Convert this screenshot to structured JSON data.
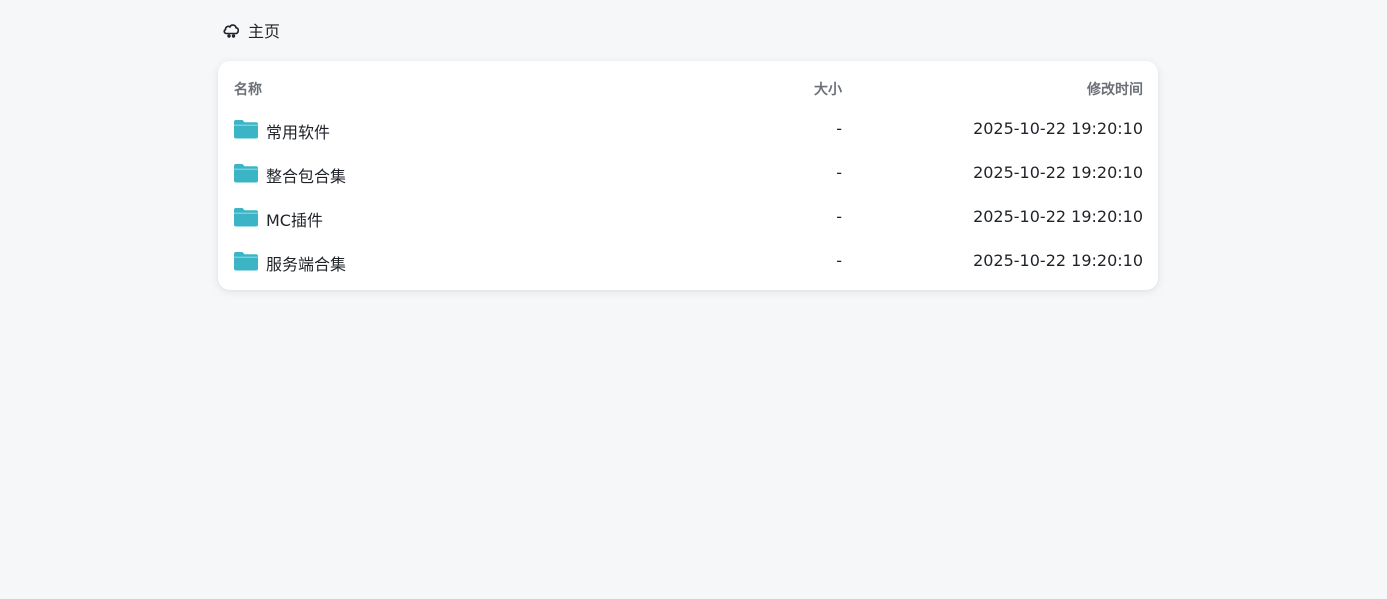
{
  "breadcrumb": {
    "home_label": "主页",
    "home_icon": "cloud-rain-icon"
  },
  "table": {
    "columns": {
      "name": "名称",
      "size": "大小",
      "modified": "修改时间"
    },
    "folder_color": "#3bb5c6",
    "rows": [
      {
        "name": "常用软件",
        "size": "-",
        "modified": "2025-10-22 19:20:10",
        "icon": "folder-icon"
      },
      {
        "name": "整合包合集",
        "size": "-",
        "modified": "2025-10-22 19:20:10",
        "icon": "folder-icon"
      },
      {
        "name": "MC插件",
        "size": "-",
        "modified": "2025-10-22 19:20:10",
        "icon": "folder-icon"
      },
      {
        "name": "服务端合集",
        "size": "-",
        "modified": "2025-10-22 19:20:10",
        "icon": "folder-icon"
      }
    ]
  }
}
